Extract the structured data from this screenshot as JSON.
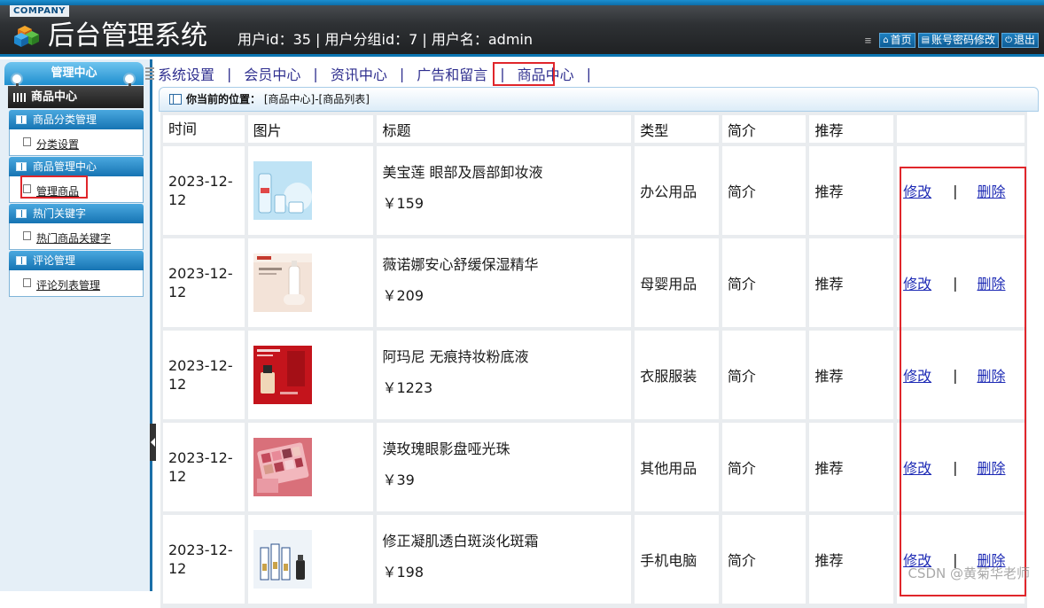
{
  "header": {
    "company": "COMPANY",
    "title": "后台管理系统",
    "user_info": "用户id：35 | 用户分组id：7 | 用户名：admin",
    "links": [
      {
        "label": "首页",
        "icon": "home-icon"
      },
      {
        "label": "账号密码修改",
        "icon": "document-icon"
      },
      {
        "label": "退出",
        "icon": "power-icon"
      }
    ]
  },
  "sidebar": {
    "head": "管理中心",
    "section": "商品中心",
    "groups": [
      {
        "title": "商品分类管理",
        "item": "分类设置"
      },
      {
        "title": "商品管理中心",
        "item": "管理商品"
      },
      {
        "title": "热门关键字",
        "item": "热门商品关键字"
      },
      {
        "title": "评论管理",
        "item": "评论列表管理"
      }
    ]
  },
  "nav": {
    "items": [
      "系统设置",
      "会员中心",
      "资讯中心",
      "广告和留言",
      "商品中心"
    ],
    "sep": "|"
  },
  "breadcrumb": {
    "label": "你当前的位置：",
    "path": "[商品中心]-[商品列表]"
  },
  "table": {
    "headers": [
      "时间",
      "图片",
      "标题",
      "类型",
      "简介",
      "推荐",
      ""
    ],
    "rows": [
      {
        "time": "2023-12-12",
        "title": "美宝莲 眼部及唇部卸妆液",
        "price": "￥159",
        "type": "办公用品",
        "intro": "简介",
        "recommend": "推荐",
        "edit": "修改",
        "delete": "删除"
      },
      {
        "time": "2023-12-12",
        "title": "薇诺娜安心舒缓保湿精华",
        "price": "￥209",
        "type": "母婴用品",
        "intro": "简介",
        "recommend": "推荐",
        "edit": "修改",
        "delete": "删除"
      },
      {
        "time": "2023-12-12",
        "title": "阿玛尼 无痕持妆粉底液",
        "price": "￥1223",
        "type": "衣服服装",
        "intro": "简介",
        "recommend": "推荐",
        "edit": "修改",
        "delete": "删除"
      },
      {
        "time": "2023-12-12",
        "title": "漠玫瑰眼影盘哑光珠",
        "price": "￥39",
        "type": "其他用品",
        "intro": "简介",
        "recommend": "推荐",
        "edit": "修改",
        "delete": "删除"
      },
      {
        "time": "2023-12-12",
        "title": "修正凝肌透白斑淡化斑霜",
        "price": "￥198",
        "type": "手机电脑",
        "intro": "简介",
        "recommend": "推荐",
        "edit": "修改",
        "delete": "删除"
      }
    ],
    "op_sep": "|"
  },
  "watermark": "CSDN @黄菊华老师",
  "colors": {
    "accent": "#1674b3",
    "highlight": "#e0262b",
    "link": "#1e2bb5"
  }
}
